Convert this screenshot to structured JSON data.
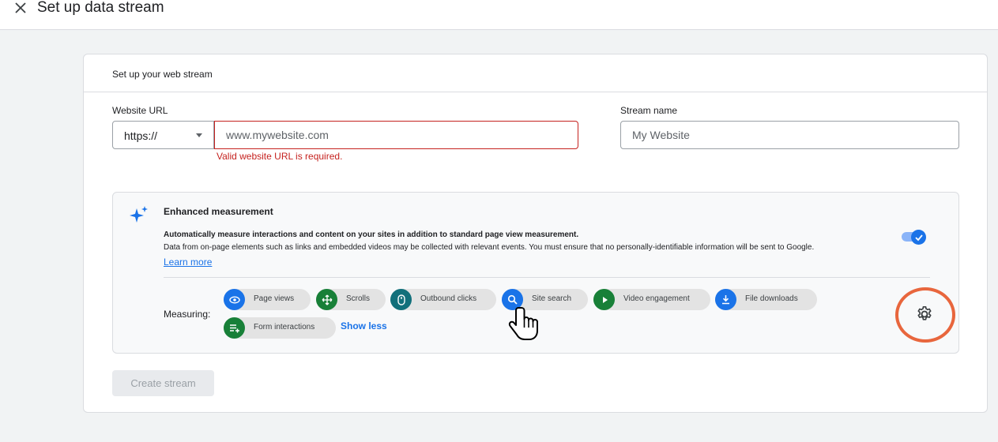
{
  "header": {
    "title": "Set up data stream",
    "close_icon": "close-icon"
  },
  "card": {
    "title": "Set up your web stream"
  },
  "website_url": {
    "label": "Website URL",
    "protocol": "https://",
    "placeholder": "www.mywebsite.com",
    "error": "Valid website URL is required."
  },
  "stream_name": {
    "label": "Stream name",
    "placeholder": "My Website"
  },
  "enhanced_measurement": {
    "title": "Enhanced measurement",
    "description": "Automatically measure interactions and content on your sites in addition to standard page view measurement.",
    "note": "Data from on-page elements such as links and embedded videos may be collected with relevant events. You must ensure that no personally-identifiable information will be sent to Google.",
    "learn_more": "Learn more",
    "enabled": true,
    "measuring_label": "Measuring:",
    "chips": [
      {
        "label": "Page views",
        "icon": "eye-icon",
        "color": "#1a73e8"
      },
      {
        "label": "Scrolls",
        "icon": "move-icon",
        "color": "#188038"
      },
      {
        "label": "Outbound clicks",
        "icon": "mouse-icon",
        "color": "#12707b"
      },
      {
        "label": "Site search",
        "icon": "search-icon",
        "color": "#1a73e8"
      },
      {
        "label": "Video engagement",
        "icon": "play-icon",
        "color": "#188038"
      },
      {
        "label": "File downloads",
        "icon": "download-icon",
        "color": "#1a73e8"
      },
      {
        "label": "Form interactions",
        "icon": "form-icon",
        "color": "#188038"
      }
    ],
    "show_less": "Show less"
  },
  "create_button": "Create stream",
  "colors": {
    "accent": "#1a73e8",
    "error": "#c5221f",
    "highlight": "#e8663d"
  }
}
